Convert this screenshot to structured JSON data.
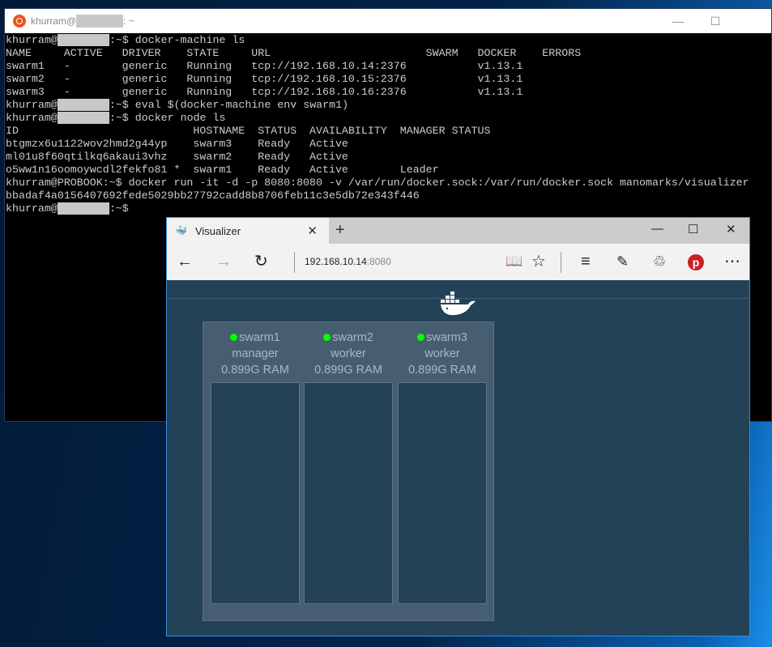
{
  "terminal": {
    "title_prefix": "khurram@",
    "title_suffix": ": ~",
    "lines": [
      {
        "pre": "khurram@",
        "redacted": true,
        "post": ":~$ docker-machine ls"
      },
      {
        "pre": "NAME     ACTIVE   DRIVER    STATE     URL                        SWARM   DOCKER    ERRORS"
      },
      {
        "pre": "swarm1   -        generic   Running   tcp://192.168.10.14:2376           v1.13.1"
      },
      {
        "pre": "swarm2   -        generic   Running   tcp://192.168.10.15:2376           v1.13.1"
      },
      {
        "pre": "swarm3   -        generic   Running   tcp://192.168.10.16:2376           v1.13.1"
      },
      {
        "pre": "khurram@",
        "redacted": true,
        "post": ":~$ eval $(docker-machine env swarm1)"
      },
      {
        "pre": "khurram@",
        "redacted": true,
        "post": ":~$ docker node ls"
      },
      {
        "pre": "ID                           HOSTNAME  STATUS  AVAILABILITY  MANAGER STATUS"
      },
      {
        "pre": "btgmzx6u1122wov2hmd2g44yp    swarm3    Ready   Active"
      },
      {
        "pre": "ml01u8f60qtilkq6akaui3vhz    swarm2    Ready   Active"
      },
      {
        "pre": "o5ww1n16oomoywcdl2fekfo81 *  swarm1    Ready   Active        Leader"
      },
      {
        "pre": "khurram@PROBOOK:~$ docker run -it -d -p 8080:8080 -v /var/run/docker.sock:/var/run/docker.sock manomarks/visualizer"
      },
      {
        "pre": "bbadaf4a0156407692fede5029bb27792cadd8b8706feb11c3e5db72e343f446"
      },
      {
        "pre": "khurram@",
        "redacted": true,
        "post": ":~$"
      }
    ],
    "minimize": "—",
    "maximize": "☐"
  },
  "browser": {
    "tab_title": "Visualizer",
    "tab_close": "✕",
    "new_tab": "+",
    "minimize": "—",
    "maximize": "☐",
    "close": "✕",
    "url_host": "192.168.10.14",
    "url_port": ":8080",
    "nodes": [
      {
        "name": "swarm1",
        "role": "manager",
        "ram": "0.899G RAM",
        "status_color": "#00ff00"
      },
      {
        "name": "swarm2",
        "role": "worker",
        "ram": "0.899G RAM",
        "status_color": "#00ff00"
      },
      {
        "name": "swarm3",
        "role": "worker",
        "ram": "0.899G RAM",
        "status_color": "#00ff00"
      }
    ]
  }
}
